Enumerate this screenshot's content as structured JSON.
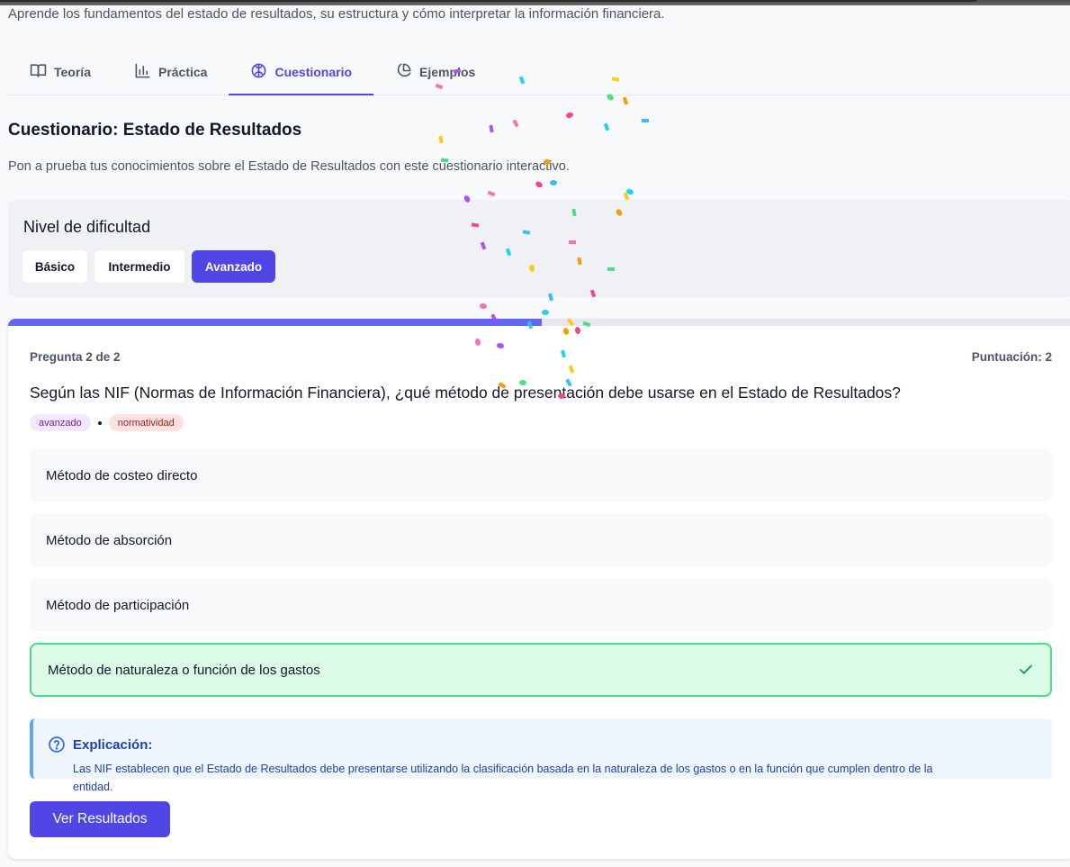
{
  "header": {
    "subtitle": "Aprende los fundamentos del estado de resultados, su estructura y cómo interpretar la información financiera."
  },
  "tabs": [
    {
      "label": "Teoría",
      "icon": "book-open-icon",
      "active": false
    },
    {
      "label": "Práctica",
      "icon": "bar-chart-icon",
      "active": false
    },
    {
      "label": "Cuestionario",
      "icon": "brain-icon",
      "active": true
    },
    {
      "label": "Ejemplos",
      "icon": "pie-chart-icon",
      "active": false
    }
  ],
  "quiz_section": {
    "title": "Cuestionario: Estado de Resultados",
    "description": "Pon a prueba tus conocimientos sobre el Estado de Resultados con este cuestionario interactivo."
  },
  "difficulty": {
    "title": "Nivel de dificultad",
    "options": [
      {
        "label": "Básico",
        "active": false
      },
      {
        "label": "Intermedio",
        "active": false
      },
      {
        "label": "Avanzado",
        "active": true
      }
    ]
  },
  "quiz": {
    "progress": 0.5,
    "counter": "Pregunta 2 de 2",
    "score": "Puntuación: 2",
    "question": "Según las NIF (Normas de Información Financiera), ¿qué método de presentación debe usarse en el Estado de Resultados?",
    "tags": {
      "level": "avanzado",
      "topic": "normatividad"
    },
    "options": [
      {
        "label": "Método de costeo directo",
        "correct": false
      },
      {
        "label": "Método de absorción",
        "correct": false
      },
      {
        "label": "Método de participación",
        "correct": false
      },
      {
        "label": "Método de naturaleza o función de los gastos",
        "correct": true
      }
    ],
    "explanation": {
      "title": "Explicación:",
      "text": "Las NIF establecen que el Estado de Resultados debe presentarse utilizando la clasificación basada en la naturaleza de los gastos o en la función que cumplen dentro de la entidad."
    },
    "results_button": "Ver Resultados"
  },
  "colors": {
    "accent": "#4f46e5",
    "correct_bg": "#dcfce7",
    "correct_border": "#4ade80",
    "explain_bg": "#eff6ff",
    "confetti": [
      "#f472b6",
      "#a855f7",
      "#22d3ee",
      "#facc15",
      "#4ade80",
      "#f59e0b",
      "#ec4899",
      "#38bdf8"
    ]
  }
}
